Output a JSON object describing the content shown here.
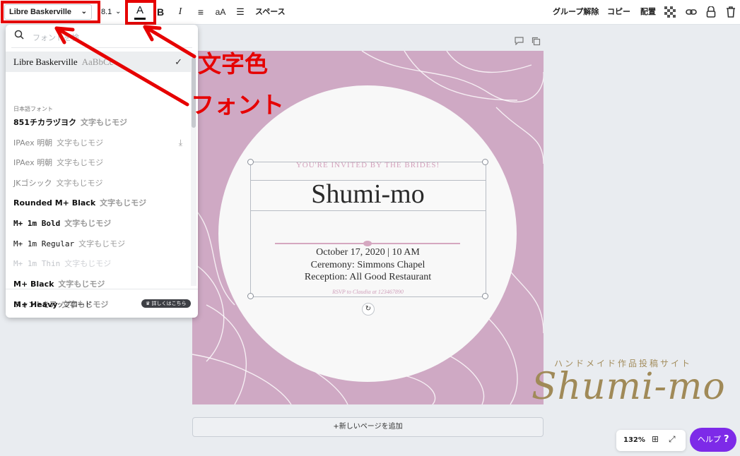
{
  "toolbar": {
    "font_name": "Libre Baskerville",
    "font_size": "8.1",
    "text_color_glyph": "A",
    "bold": "B",
    "italic": "I",
    "case": "aA",
    "spacing_label": "スペース",
    "ungroup_label": "グループ解除",
    "copy_label": "コピー",
    "position_label": "配置"
  },
  "font_dropdown": {
    "search_placeholder": "フォントを検",
    "selected": {
      "name": "Libre Baskerville",
      "sample": "AaBbCc"
    },
    "group_label": "日本語フォント",
    "items": [
      {
        "name": "851チカラヅヨク",
        "sample": "文字もじモジ"
      },
      {
        "name": "IPAex 明朝",
        "sample": "文字もじモジ"
      },
      {
        "name": "IPAex 明朝",
        "sample": "文字もじモジ"
      },
      {
        "name": "JKゴシック",
        "sample": "文字もじモジ"
      },
      {
        "name": "Rounded M+ Black",
        "sample": "文字もじモジ"
      },
      {
        "name": "M+ 1m Bold",
        "sample": "文字もじモジ"
      },
      {
        "name": "M+ 1m Regular",
        "sample": "文字もじモジ"
      },
      {
        "name": "M+ 1m Thin",
        "sample": "文字もじモジ"
      },
      {
        "name": "M+ Black",
        "sample": "文字もじモジ"
      },
      {
        "name": "M+ Heavy",
        "sample": "文字もじモジ"
      }
    ],
    "upload_label": "フォントをアップロード",
    "pro_badge": "詳しくはこちら"
  },
  "design": {
    "invite": "YOU'RE INVITED BY THE BRIDES!",
    "title": "Shumi-mo",
    "date_line": "October 17, 2020 | 10 AM",
    "ceremony_line": "Ceremony: Simmons Chapel",
    "reception_line": "Reception: All Good Restaurant",
    "rsvp_line": "RSVP to Claudia at 123467890",
    "background_color": "#cfa9c4"
  },
  "add_page_label": "+新しいページを追加",
  "zoom_label": "132%",
  "help_label": "ヘルプ",
  "help_q": "?",
  "annotations": {
    "text_color": "文字色",
    "font": "フォント"
  },
  "watermark": {
    "subtitle": "ハンドメイド作品投稿サイト",
    "logo": "Shumi-mo"
  }
}
